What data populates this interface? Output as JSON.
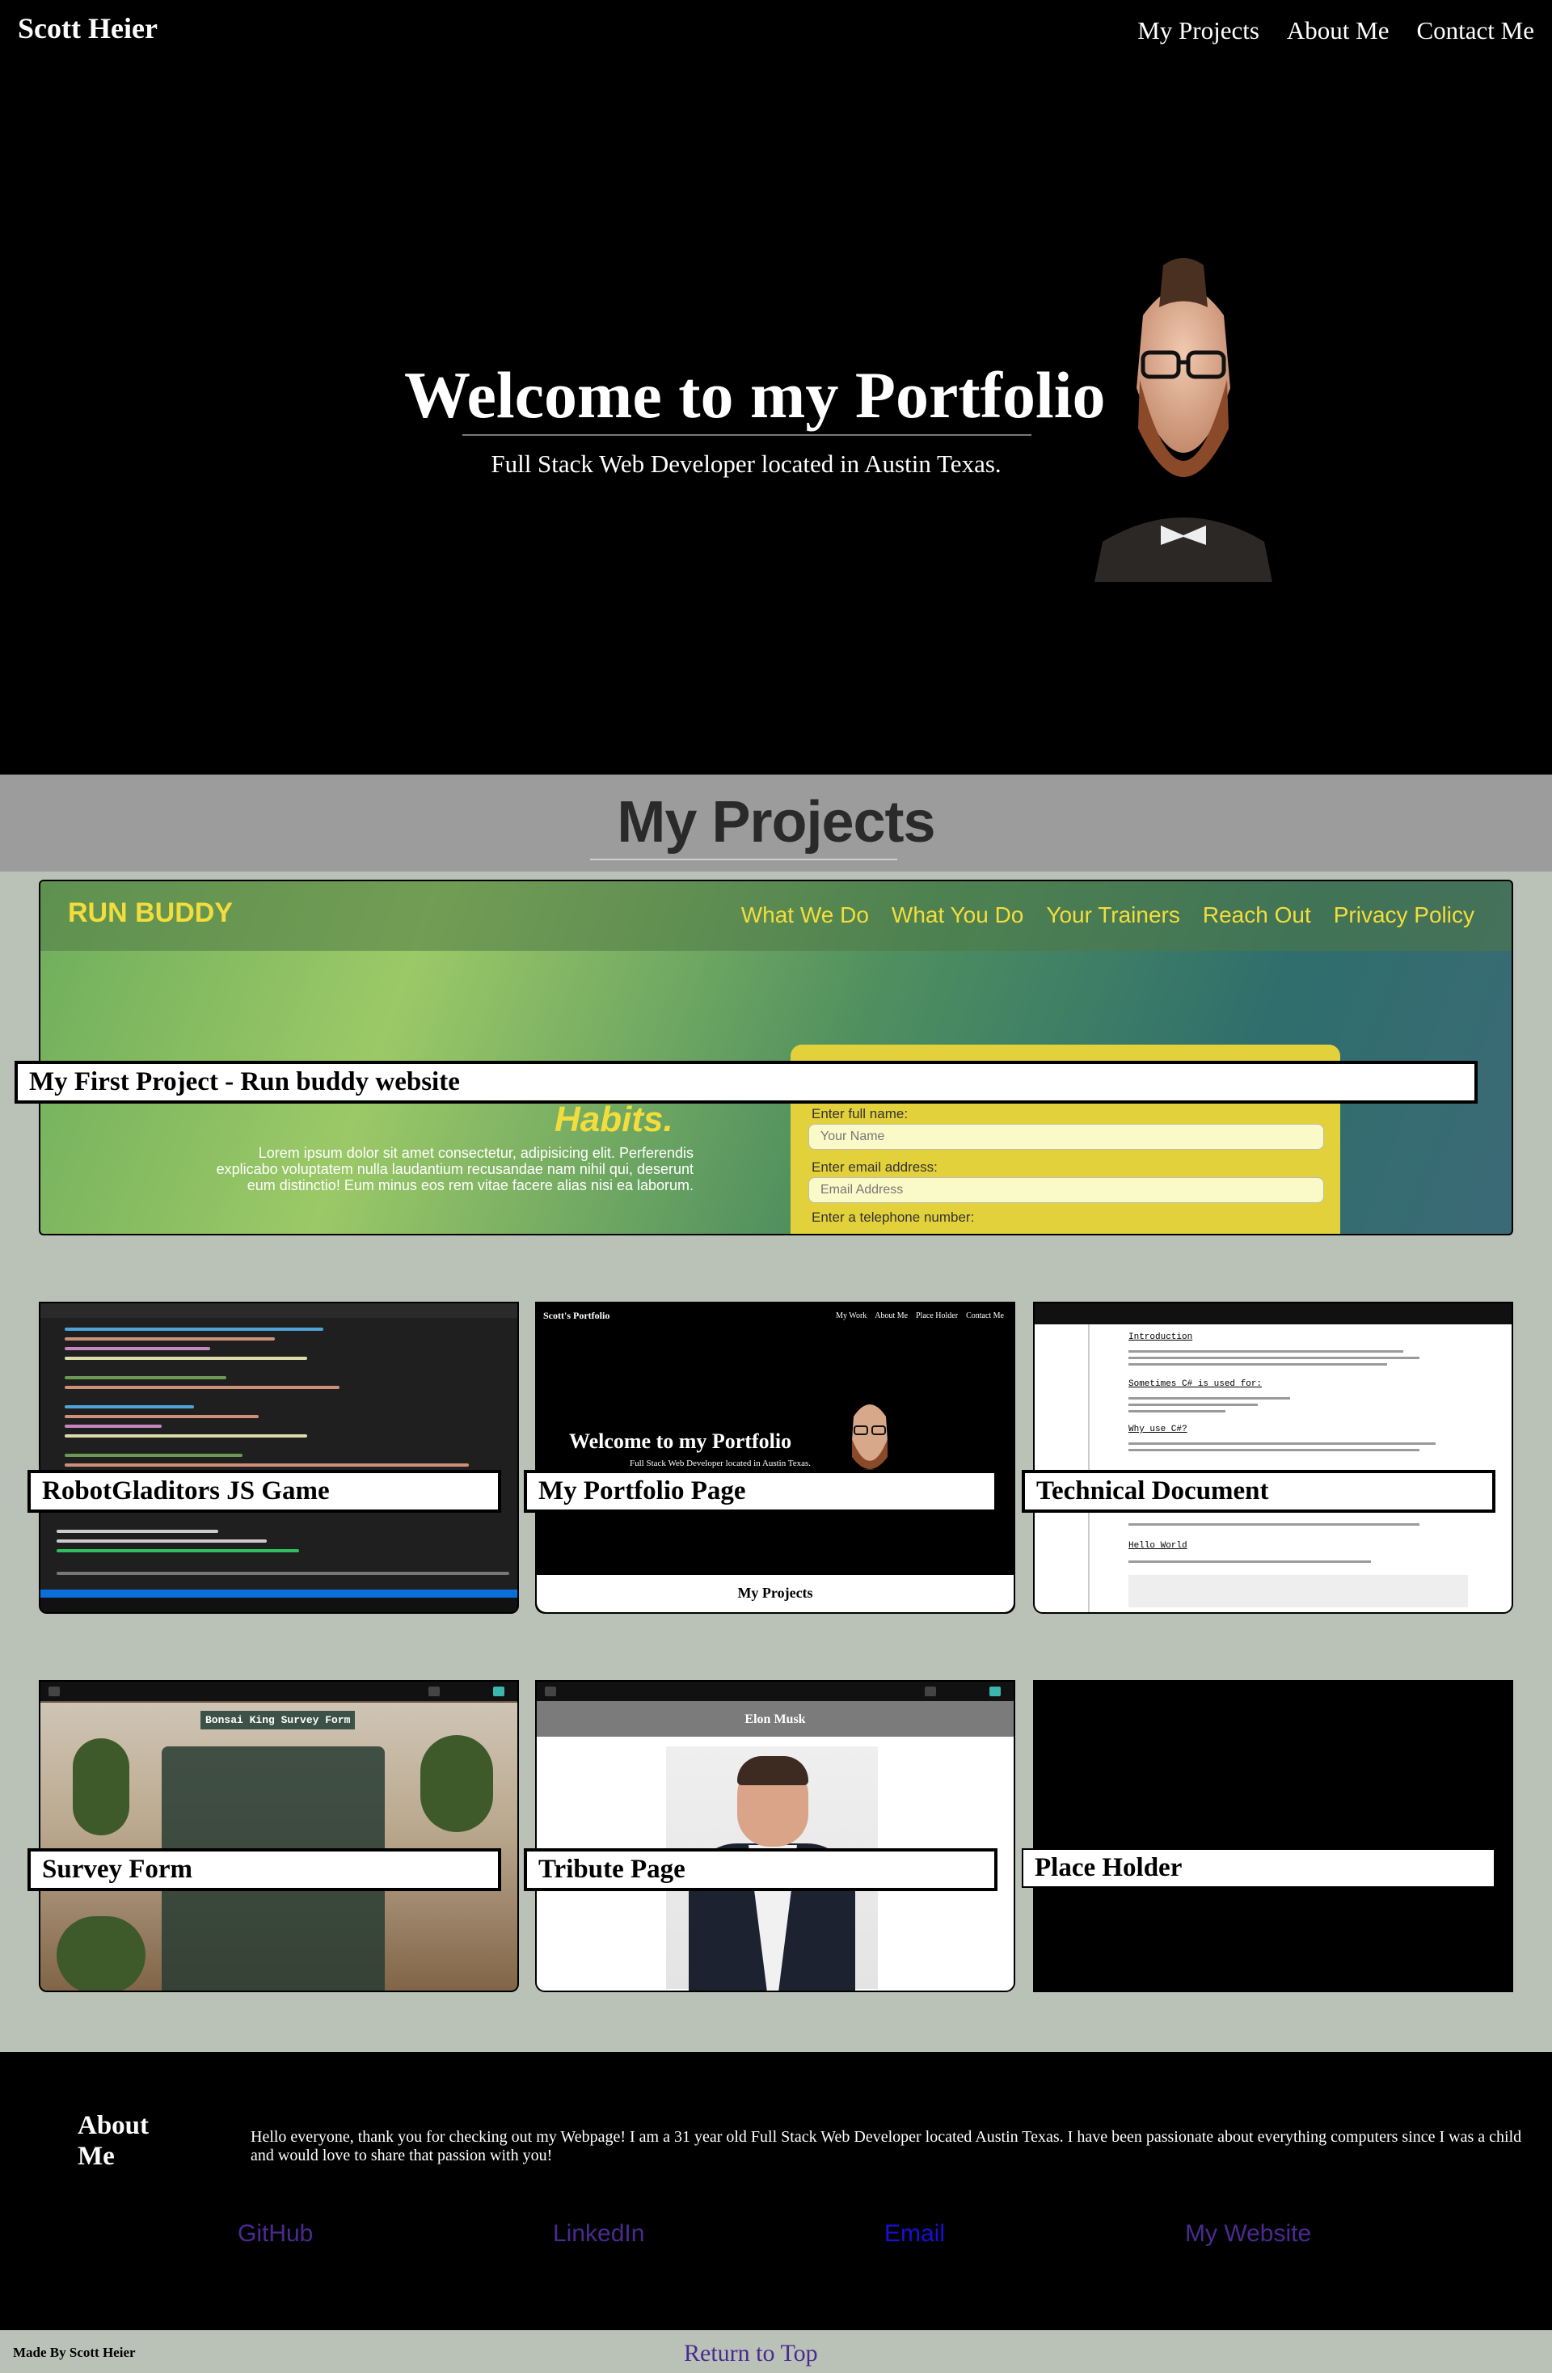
{
  "header": {
    "brand": "Scott Heier",
    "nav": [
      "My Projects",
      "About Me",
      "Contact Me"
    ]
  },
  "hero": {
    "title": "Welcome to my Portfolio",
    "subtitle": "Full Stack Web Developer located in Austin Texas."
  },
  "projects": {
    "title": "My Projects",
    "featured": {
      "label": "My First Project - Run buddy website",
      "preview": {
        "logo": "RUN BUDDY",
        "nav": [
          "What We Do",
          "What You Do",
          "Your Trainers",
          "Reach Out",
          "Privacy Policy"
        ],
        "headline": "Habits.",
        "lorem": "Lorem ipsum dolor sit amet consectetur, adipisicing elit. Perferendis explicabo voluptatem nulla laudantium recusandae nam nihil qui, deserunt eum distinctio! Eum minus eos rem vitae facere alias nisi ea laborum.",
        "form_labels": [
          "Enter full name:",
          "Enter email address:",
          "Enter a telephone number:"
        ],
        "form_placeholders": [
          "Your Name",
          "Email Address"
        ]
      }
    },
    "cards": [
      {
        "label": "RobotGladitors JS Game"
      },
      {
        "label": "My Portfolio Page"
      },
      {
        "label": "Technical Document"
      },
      {
        "label": "Survey Form"
      },
      {
        "label": "Tribute Page"
      },
      {
        "label": "Place Holder"
      }
    ],
    "portfolio_thumb": {
      "brand": "Scott's Portfolio",
      "nav": [
        "My Work",
        "About Me",
        "Place Holder",
        "Contact Me"
      ],
      "title": "Welcome to my Portfolio",
      "subtitle": "Full Stack Web Developer located in Austin Texas.",
      "footer": "My Projects"
    },
    "techdoc_thumb": {
      "headings": [
        "Introduction",
        "Sometimes C# is used for:",
        "Why use C#?",
        "Hello World"
      ]
    },
    "survey_thumb": {
      "title": "Bonsai King Survey Form"
    },
    "tribute_thumb": {
      "title": "Elon Musk"
    }
  },
  "about": {
    "heading": "About Me",
    "text": "Hello everyone, thank you for checking out my Webpage! I am a 31 year old Full Stack Web Developer located Austin Texas. I have been passionate about everything computers since I was a child and would love to share that passion with you!",
    "links": [
      "GitHub",
      "LinkedIn",
      "Email",
      "My Website"
    ]
  },
  "footer": {
    "made_by": "Made By Scott Heier",
    "return_top": "Return to Top"
  },
  "colors": {
    "background": "#000000",
    "projects_band": "#9c9c9c",
    "projects_area": "#bac1b6",
    "run_buddy_yellow": "#f3dd3c",
    "link_visited": "#4b2a8f",
    "link_email": "#1a0fd6"
  }
}
